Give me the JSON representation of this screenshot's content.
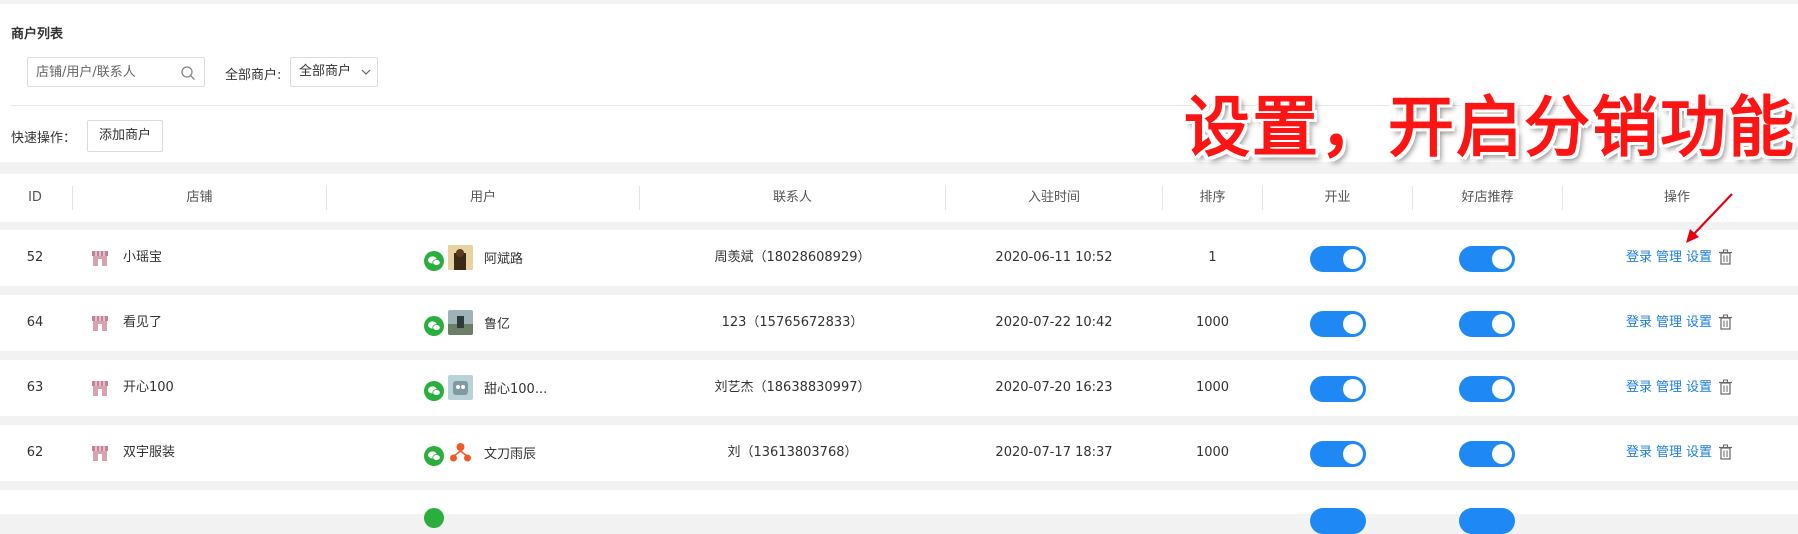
{
  "page": {
    "title": "商户列表"
  },
  "search": {
    "placeholder": "店铺/用户/联系人"
  },
  "filter": {
    "label": "全部商户:",
    "selected": "全部商户"
  },
  "quick": {
    "label": "快速操作：",
    "add_label": "添加商户"
  },
  "annotation": {
    "text": "设置，开启分销功能",
    "color": "#ff1414"
  },
  "accent": "#1e88f5",
  "table": {
    "headers": [
      "ID",
      "店铺",
      "用户",
      "联系人",
      "入驻时间",
      "排序",
      "开业",
      "好店推荐",
      "操作"
    ],
    "actions": {
      "login": "登录",
      "manage": "管理",
      "settings": "设置"
    },
    "rows": [
      {
        "id": "52",
        "shop": "小瑶宝",
        "user": "阿斌路",
        "contact": "周羡斌（18028608929）",
        "time": "2020-06-11 10:52",
        "sort": "1",
        "open": true,
        "recommend": true
      },
      {
        "id": "64",
        "shop": "看见了",
        "user": "鲁亿",
        "contact": "123（15765672833）",
        "time": "2020-07-22 10:42",
        "sort": "1000",
        "open": true,
        "recommend": true
      },
      {
        "id": "63",
        "shop": "开心100",
        "user": "甜心100...",
        "contact": "刘艺杰（18638830997）",
        "time": "2020-07-20 16:23",
        "sort": "1000",
        "open": true,
        "recommend": true
      },
      {
        "id": "62",
        "shop": "双宇服装",
        "user": "文刀雨辰",
        "contact": "刘（13613803768）",
        "time": "2020-07-17 18:37",
        "sort": "1000",
        "open": true,
        "recommend": true
      }
    ]
  }
}
